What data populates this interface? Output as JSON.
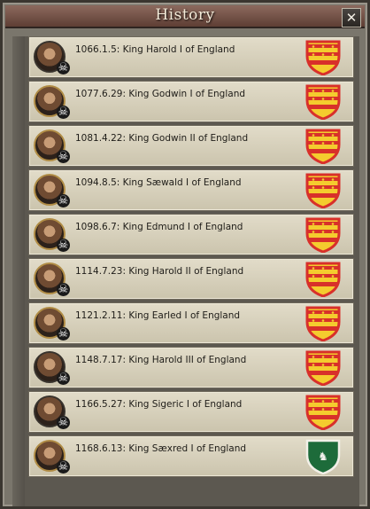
{
  "window": {
    "title": "History",
    "close_glyph": "✕",
    "close_icon": "close-icon"
  },
  "entries": [
    {
      "text": "1066.1.5: King Harold I of England",
      "coa": "england-red-gold",
      "frame": "dark"
    },
    {
      "text": "1077.6.29: King Godwin I of England",
      "coa": "england-red-gold",
      "frame": "gold"
    },
    {
      "text": "1081.4.22: King Godwin II of England",
      "coa": "england-red-gold",
      "frame": "gold"
    },
    {
      "text": "1094.8.5: King Sæwald I of England",
      "coa": "england-red-gold",
      "frame": "gold"
    },
    {
      "text": "1098.6.7: King Edmund I of England",
      "coa": "england-red-gold",
      "frame": "gold"
    },
    {
      "text": "1114.7.23: King Harold II of England",
      "coa": "england-red-gold",
      "frame": "gold"
    },
    {
      "text": "1121.2.11: King Earled I of England",
      "coa": "england-red-gold",
      "frame": "gold"
    },
    {
      "text": "1148.7.17: King Harold III of England",
      "coa": "england-red-gold",
      "frame": "dark"
    },
    {
      "text": "1166.5.27: King Sigeric I of England",
      "coa": "england-red-gold",
      "frame": "dark"
    },
    {
      "text": "1168.6.13: King Sæxred I of England",
      "coa": "green-white-stag",
      "frame": "gold"
    }
  ],
  "deceased_icon": "skull-icon",
  "colors": {
    "shield_red": "#d8302a",
    "shield_gold": "#f4cc2e",
    "shield_green": "#1d6b3a",
    "shield_white": "#f1f1ec"
  }
}
